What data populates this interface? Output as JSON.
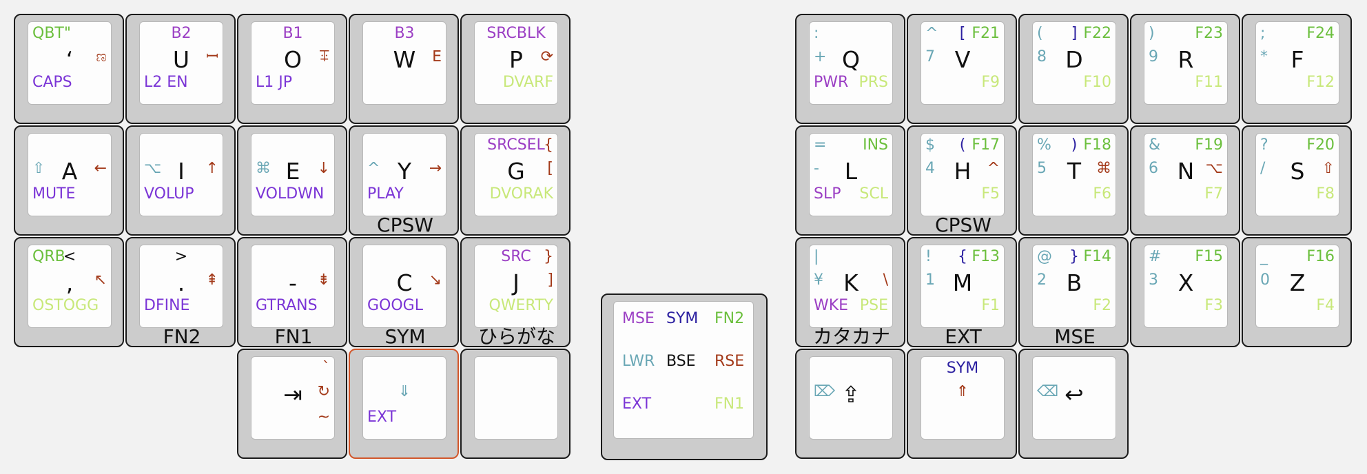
{
  "colors": {
    "default": "#111111",
    "purple": "#9b3fc4",
    "navy": "#2b1fa0",
    "green": "#6bbf3d",
    "teal": "#6aa7b5",
    "violet": "#7b35d6",
    "lime": "#c8e87a",
    "brown": "#a33a1a"
  },
  "keys": [
    {
      "name": "key-qbt",
      "legends": [
        [
          "t",
          "l",
          "QBT\"",
          "green"
        ],
        [
          "m",
          "c",
          "‘",
          "default"
        ],
        [
          "m",
          "r",
          "ಣ",
          "brown"
        ],
        [
          "b",
          "l",
          "CAPS",
          "violet"
        ]
      ]
    },
    {
      "name": "key-u",
      "legends": [
        [
          "t",
          "c",
          "B2",
          "purple"
        ],
        [
          "m",
          "c",
          "U",
          "default"
        ],
        [
          "m",
          "r",
          "ꟷ",
          "brown"
        ],
        [
          "b",
          "l",
          "L2 EN",
          "violet"
        ]
      ]
    },
    {
      "name": "key-o",
      "legends": [
        [
          "t",
          "c",
          "B1",
          "purple"
        ],
        [
          "m",
          "c",
          "O",
          "default"
        ],
        [
          "m",
          "r",
          "ꔊ",
          "brown"
        ],
        [
          "b",
          "l",
          "L1 JP",
          "violet"
        ]
      ]
    },
    {
      "name": "key-w",
      "legends": [
        [
          "t",
          "c",
          "B3",
          "purple"
        ],
        [
          "m",
          "c",
          "W",
          "default"
        ],
        [
          "m",
          "r",
          "ⴹ",
          "brown"
        ]
      ]
    },
    {
      "name": "key-p",
      "legends": [
        [
          "t",
          "c",
          "SRCBLK",
          "purple"
        ],
        [
          "m",
          "c",
          "P",
          "default"
        ],
        [
          "m",
          "r",
          "⟳",
          "brown"
        ],
        [
          "b",
          "r",
          "DVARF",
          "lime"
        ]
      ]
    },
    {
      "name": "key-q",
      "legends": [
        [
          "t",
          "l",
          ":",
          "teal"
        ],
        [
          "m",
          "l",
          "+",
          "teal"
        ],
        [
          "m",
          "c",
          "Q",
          "default"
        ],
        [
          "b",
          "l",
          "PWR",
          "purple"
        ],
        [
          "b",
          "r",
          "PRS",
          "lime"
        ]
      ]
    },
    {
      "name": "key-v",
      "legends": [
        [
          "t",
          "l",
          "^",
          "teal"
        ],
        [
          "t",
          "c",
          "[",
          "navy"
        ],
        [
          "t",
          "r",
          "F21",
          "green"
        ],
        [
          "m",
          "l",
          "7",
          "teal"
        ],
        [
          "m",
          "c",
          "V",
          "default"
        ],
        [
          "b",
          "r",
          "F9",
          "lime"
        ]
      ]
    },
    {
      "name": "key-d",
      "legends": [
        [
          "t",
          "l",
          "(",
          "teal"
        ],
        [
          "t",
          "c",
          "]",
          "navy"
        ],
        [
          "t",
          "r",
          "F22",
          "green"
        ],
        [
          "m",
          "l",
          "8",
          "teal"
        ],
        [
          "m",
          "c",
          "D",
          "default"
        ],
        [
          "b",
          "r",
          "F10",
          "lime"
        ]
      ]
    },
    {
      "name": "key-r",
      "legends": [
        [
          "t",
          "l",
          ")",
          "teal"
        ],
        [
          "t",
          "r",
          "F23",
          "green"
        ],
        [
          "m",
          "l",
          "9",
          "teal"
        ],
        [
          "m",
          "c",
          "R",
          "default"
        ],
        [
          "b",
          "r",
          "F11",
          "lime"
        ]
      ]
    },
    {
      "name": "key-f",
      "legends": [
        [
          "t",
          "l",
          ";",
          "teal"
        ],
        [
          "t",
          "r",
          "F24",
          "green"
        ],
        [
          "m",
          "l",
          "*",
          "teal"
        ],
        [
          "m",
          "c",
          "F",
          "default"
        ],
        [
          "b",
          "r",
          "F12",
          "lime"
        ]
      ]
    },
    {
      "name": "key-a",
      "legends": [
        [
          "m",
          "l",
          "⇧",
          "teal"
        ],
        [
          "m",
          "c",
          "A",
          "default"
        ],
        [
          "m",
          "r",
          "←",
          "brown"
        ],
        [
          "b",
          "l",
          "MUTE",
          "violet"
        ]
      ]
    },
    {
      "name": "key-i",
      "legends": [
        [
          "m",
          "l",
          "⌥",
          "teal"
        ],
        [
          "m",
          "c",
          "I",
          "default"
        ],
        [
          "m",
          "r",
          "↑",
          "brown"
        ],
        [
          "b",
          "l",
          "VOLUP",
          "violet"
        ]
      ]
    },
    {
      "name": "key-e",
      "legends": [
        [
          "m",
          "l",
          "⌘",
          "teal"
        ],
        [
          "m",
          "c",
          "E",
          "default"
        ],
        [
          "m",
          "r",
          "↓",
          "brown"
        ],
        [
          "b",
          "l",
          "VOLDWN",
          "violet"
        ]
      ]
    },
    {
      "name": "key-y",
      "legends": [
        [
          "m",
          "l",
          "^",
          "teal"
        ],
        [
          "m",
          "c",
          "Y",
          "default"
        ],
        [
          "m",
          "r",
          "→",
          "brown"
        ],
        [
          "b",
          "l",
          "PLAY",
          "violet"
        ]
      ],
      "hold": "CPSW"
    },
    {
      "name": "key-g",
      "legends": [
        [
          "t",
          "c",
          "SRCSEL",
          "purple"
        ],
        [
          "t",
          "r",
          "{",
          "brown"
        ],
        [
          "m",
          "c",
          "G",
          "default"
        ],
        [
          "m",
          "r",
          "[",
          "brown"
        ],
        [
          "b",
          "r",
          "DVORAK",
          "lime"
        ]
      ]
    },
    {
      "name": "key-l",
      "legends": [
        [
          "t",
          "l",
          "=",
          "teal"
        ],
        [
          "t",
          "r",
          "INS",
          "green"
        ],
        [
          "m",
          "l",
          "-",
          "teal"
        ],
        [
          "m",
          "c",
          "L",
          "default"
        ],
        [
          "b",
          "l",
          "SLP",
          "purple"
        ],
        [
          "b",
          "r",
          "SCL",
          "lime"
        ]
      ]
    },
    {
      "name": "key-h",
      "legends": [
        [
          "t",
          "l",
          "$",
          "teal"
        ],
        [
          "t",
          "c",
          "(",
          "navy"
        ],
        [
          "t",
          "r",
          "F17",
          "green"
        ],
        [
          "m",
          "l",
          "4",
          "teal"
        ],
        [
          "m",
          "c",
          "H",
          "default"
        ],
        [
          "m",
          "r",
          "^",
          "brown"
        ],
        [
          "b",
          "r",
          "F5",
          "lime"
        ]
      ],
      "hold": "CPSW"
    },
    {
      "name": "key-t",
      "legends": [
        [
          "t",
          "l",
          "%",
          "teal"
        ],
        [
          "t",
          "c",
          ")",
          "navy"
        ],
        [
          "t",
          "r",
          "F18",
          "green"
        ],
        [
          "m",
          "l",
          "5",
          "teal"
        ],
        [
          "m",
          "c",
          "T",
          "default"
        ],
        [
          "m",
          "r",
          "⌘",
          "brown"
        ],
        [
          "b",
          "r",
          "F6",
          "lime"
        ]
      ]
    },
    {
      "name": "key-n",
      "legends": [
        [
          "t",
          "l",
          "&",
          "teal"
        ],
        [
          "t",
          "r",
          "F19",
          "green"
        ],
        [
          "m",
          "l",
          "6",
          "teal"
        ],
        [
          "m",
          "c",
          "N",
          "default"
        ],
        [
          "m",
          "r",
          "⌥",
          "brown"
        ],
        [
          "b",
          "r",
          "F7",
          "lime"
        ]
      ]
    },
    {
      "name": "key-s",
      "legends": [
        [
          "t",
          "l",
          "?",
          "teal"
        ],
        [
          "t",
          "r",
          "F20",
          "green"
        ],
        [
          "m",
          "l",
          "/",
          "teal"
        ],
        [
          "m",
          "c",
          "S",
          "default"
        ],
        [
          "m",
          "r",
          "⇧",
          "brown"
        ],
        [
          "b",
          "r",
          "F8",
          "lime"
        ]
      ]
    },
    {
      "name": "key-comma",
      "legends": [
        [
          "t",
          "l",
          "QRB",
          "green"
        ],
        [
          "t",
          "c",
          "<",
          "default"
        ],
        [
          "m",
          "c",
          ",",
          "default"
        ],
        [
          "m",
          "r",
          "↖",
          "brown"
        ],
        [
          "b",
          "l",
          "OSTOGG",
          "lime"
        ]
      ]
    },
    {
      "name": "key-dot",
      "legends": [
        [
          "t",
          "c",
          ">",
          "default"
        ],
        [
          "m",
          "c",
          ".",
          "default"
        ],
        [
          "m",
          "r",
          "⇞",
          "brown"
        ],
        [
          "b",
          "l",
          "DFINE",
          "violet"
        ]
      ],
      "hold": "FN2"
    },
    {
      "name": "key-minus",
      "legends": [
        [
          "m",
          "c",
          "-",
          "default"
        ],
        [
          "m",
          "r",
          "⇟",
          "brown"
        ],
        [
          "b",
          "l",
          "GTRANS",
          "violet"
        ]
      ],
      "hold": "FN1"
    },
    {
      "name": "key-c",
      "legends": [
        [
          "m",
          "c",
          "C",
          "default"
        ],
        [
          "m",
          "r",
          "↘",
          "brown"
        ],
        [
          "b",
          "l",
          "GOOGL",
          "violet"
        ]
      ],
      "hold": "SYM"
    },
    {
      "name": "key-j",
      "legends": [
        [
          "t",
          "c",
          "SRC",
          "purple"
        ],
        [
          "t",
          "r",
          "}",
          "brown"
        ],
        [
          "m",
          "c",
          "J",
          "default"
        ],
        [
          "m",
          "r",
          "]",
          "brown"
        ],
        [
          "b",
          "r",
          "QWERTY",
          "lime"
        ]
      ],
      "hold": "ひらがな"
    },
    {
      "name": "key-k",
      "legends": [
        [
          "t",
          "l",
          "|",
          "teal"
        ],
        [
          "m",
          "l",
          "¥",
          "teal"
        ],
        [
          "m",
          "c",
          "K",
          "default"
        ],
        [
          "m",
          "r",
          "\\",
          "brown"
        ],
        [
          "b",
          "l",
          "WKE",
          "purple"
        ],
        [
          "b",
          "r",
          "PSE",
          "lime"
        ]
      ],
      "hold": "カタカナ"
    },
    {
      "name": "key-m",
      "legends": [
        [
          "t",
          "l",
          "!",
          "teal"
        ],
        [
          "t",
          "c",
          "{",
          "navy"
        ],
        [
          "t",
          "r",
          "F13",
          "green"
        ],
        [
          "m",
          "l",
          "1",
          "teal"
        ],
        [
          "m",
          "c",
          "M",
          "default"
        ],
        [
          "b",
          "r",
          "F1",
          "lime"
        ]
      ],
      "hold": "EXT"
    },
    {
      "name": "key-b",
      "legends": [
        [
          "t",
          "l",
          "@",
          "teal"
        ],
        [
          "t",
          "c",
          "}",
          "navy"
        ],
        [
          "t",
          "r",
          "F14",
          "green"
        ],
        [
          "m",
          "l",
          "2",
          "teal"
        ],
        [
          "m",
          "c",
          "B",
          "default"
        ],
        [
          "b",
          "r",
          "F2",
          "lime"
        ]
      ],
      "hold": "MSE"
    },
    {
      "name": "key-x",
      "legends": [
        [
          "t",
          "l",
          "#",
          "teal"
        ],
        [
          "t",
          "r",
          "F15",
          "green"
        ],
        [
          "m",
          "l",
          "3",
          "teal"
        ],
        [
          "m",
          "c",
          "X",
          "default"
        ],
        [
          "b",
          "r",
          "F3",
          "lime"
        ]
      ]
    },
    {
      "name": "key-z",
      "legends": [
        [
          "t",
          "l",
          "_",
          "teal"
        ],
        [
          "t",
          "r",
          "F16",
          "green"
        ],
        [
          "m",
          "l",
          "0",
          "teal"
        ],
        [
          "m",
          "c",
          "Z",
          "default"
        ],
        [
          "b",
          "r",
          "F4",
          "lime"
        ]
      ]
    },
    {
      "name": "key-tab",
      "legends": [
        [
          "t",
          "r",
          "`",
          "brown"
        ],
        [
          "m",
          "c",
          "⇥",
          "default"
        ],
        [
          "m",
          "r",
          "↻",
          "brown"
        ],
        [
          "b",
          "r",
          "~",
          "brown"
        ]
      ]
    },
    {
      "name": "key-ext-thumb",
      "legends": [
        [
          "m",
          "c",
          "⇓",
          "teal"
        ],
        [
          "b",
          "l",
          "EXT",
          "violet"
        ]
      ],
      "highlight": true
    },
    {
      "name": "key-blank-thumb",
      "legends": []
    },
    {
      "name": "key-shift-thumb",
      "legends": [
        [
          "m",
          "l",
          "⌦",
          "teal"
        ],
        [
          "m",
          "c",
          "⇪",
          "default"
        ]
      ]
    },
    {
      "name": "key-sym-thumb",
      "legends": [
        [
          "t",
          "c",
          "SYM",
          "navy"
        ],
        [
          "m",
          "c",
          "⇑",
          "brown"
        ]
      ]
    },
    {
      "name": "key-enter-thumb",
      "legends": [
        [
          "m",
          "l",
          "⌫",
          "teal"
        ],
        [
          "m",
          "c",
          "↩",
          "default"
        ]
      ]
    }
  ],
  "combos": {
    "left": "SYM",
    "right": "CPSW"
  },
  "legend_key": {
    "rows": [
      [
        [
          "MSE",
          "purple"
        ],
        [
          "SYM",
          "navy"
        ],
        [
          "FN2",
          "green"
        ]
      ],
      [
        [
          "LWR",
          "teal"
        ],
        [
          "BSE",
          "default"
        ],
        [
          "RSE",
          "brown"
        ]
      ],
      [
        [
          "EXT",
          "violet"
        ],
        [
          "",
          ""
        ],
        [
          "FN1",
          "lime"
        ]
      ]
    ]
  }
}
